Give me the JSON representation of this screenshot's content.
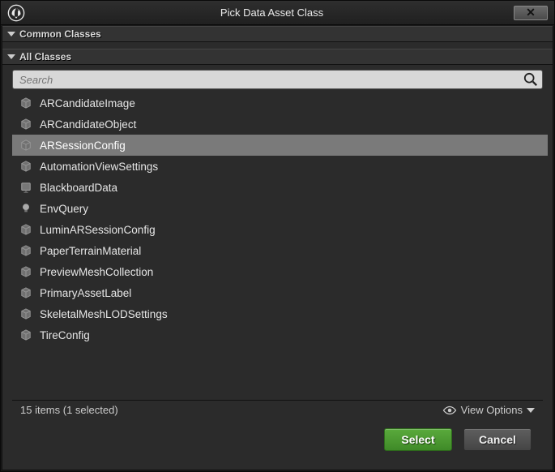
{
  "window": {
    "title": "Pick Data Asset Class"
  },
  "sections": {
    "common": "Common Classes",
    "all": "All Classes"
  },
  "search": {
    "placeholder": "Search"
  },
  "items": [
    {
      "label": "ARCandidateImage",
      "icon": "cube",
      "selected": false
    },
    {
      "label": "ARCandidateObject",
      "icon": "cube",
      "selected": false
    },
    {
      "label": "ARSessionConfig",
      "icon": "cube",
      "selected": true
    },
    {
      "label": "AutomationViewSettings",
      "icon": "cube",
      "selected": false
    },
    {
      "label": "BlackboardData",
      "icon": "board",
      "selected": false
    },
    {
      "label": "EnvQuery",
      "icon": "bulb",
      "selected": false
    },
    {
      "label": "LuminARSessionConfig",
      "icon": "cube",
      "selected": false
    },
    {
      "label": "PaperTerrainMaterial",
      "icon": "cube",
      "selected": false
    },
    {
      "label": "PreviewMeshCollection",
      "icon": "cube",
      "selected": false
    },
    {
      "label": "PrimaryAssetLabel",
      "icon": "cube",
      "selected": false
    },
    {
      "label": "SkeletalMeshLODSettings",
      "icon": "cube",
      "selected": false
    },
    {
      "label": "TireConfig",
      "icon": "cube",
      "selected": false
    }
  ],
  "status": {
    "text": "15 items (1 selected)",
    "view_options": "View Options"
  },
  "buttons": {
    "select": "Select",
    "cancel": "Cancel"
  }
}
